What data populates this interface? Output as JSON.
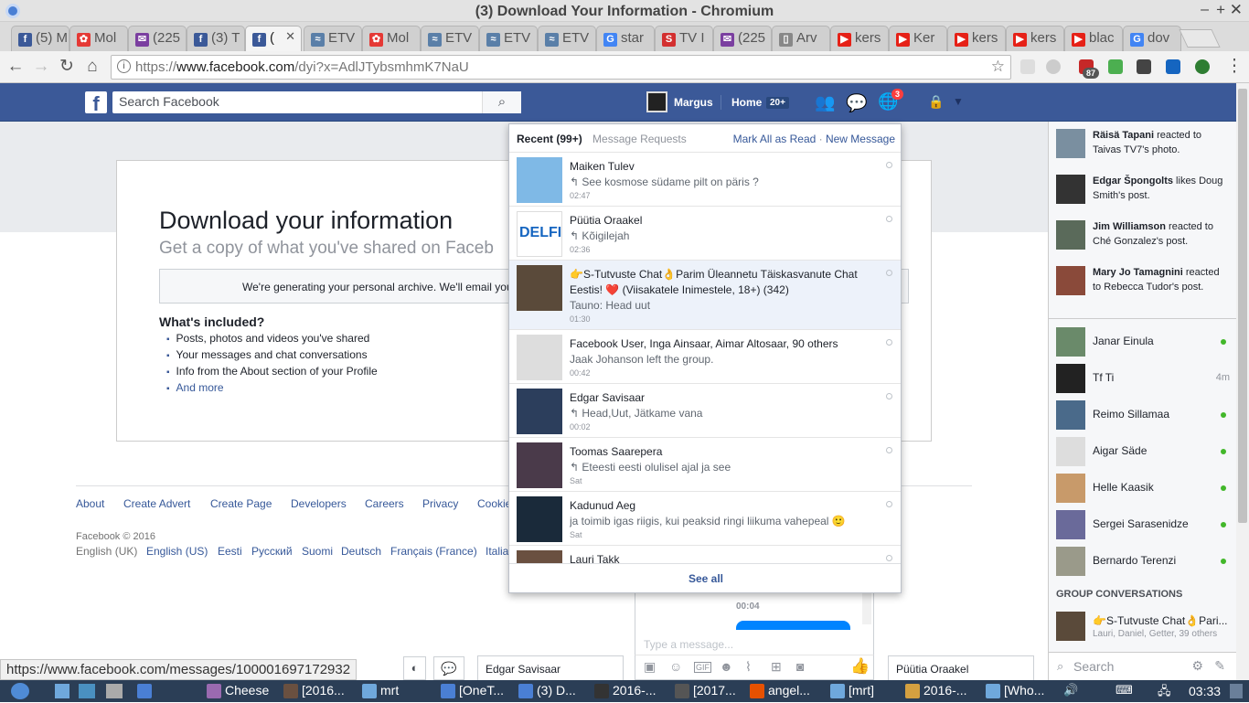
{
  "window": {
    "title": "(3) Download Your Information - Chromium"
  },
  "tabs": [
    {
      "label": "(5) M",
      "color": "#3b5998",
      "glyph": "f"
    },
    {
      "label": "Mol",
      "color": "#e53935",
      "glyph": "✿"
    },
    {
      "label": "(225",
      "color": "#7b3fa0",
      "glyph": "✉"
    },
    {
      "label": "(3) T",
      "color": "#3b5998",
      "glyph": "f"
    },
    {
      "label": "(",
      "color": "#3b5998",
      "glyph": "f",
      "active": true
    },
    {
      "label": "ETV",
      "color": "#5a7fa8",
      "glyph": "≈"
    },
    {
      "label": "Mol",
      "color": "#e53935",
      "glyph": "✿"
    },
    {
      "label": "ETV",
      "color": "#5a7fa8",
      "glyph": "≈"
    },
    {
      "label": "ETV",
      "color": "#5a7fa8",
      "glyph": "≈"
    },
    {
      "label": "ETV",
      "color": "#5a7fa8",
      "glyph": "≈"
    },
    {
      "label": "star",
      "color": "#4285f4",
      "glyph": "G"
    },
    {
      "label": "TV I",
      "color": "#d32f2f",
      "glyph": "S"
    },
    {
      "label": "(225",
      "color": "#7b3fa0",
      "glyph": "✉"
    },
    {
      "label": "Arv",
      "color": "#888888",
      "glyph": "▯"
    },
    {
      "label": "kers",
      "color": "#e62117",
      "glyph": "▶"
    },
    {
      "label": "Ker",
      "color": "#e62117",
      "glyph": "▶"
    },
    {
      "label": "kers",
      "color": "#e62117",
      "glyph": "▶"
    },
    {
      "label": "kers",
      "color": "#e62117",
      "glyph": "▶"
    },
    {
      "label": "blac",
      "color": "#e62117",
      "glyph": "▶"
    },
    {
      "label": "dov",
      "color": "#4285f4",
      "glyph": "G"
    }
  ],
  "omnibox": {
    "scheme": "https://",
    "host": "www.facebook.com",
    "path": "/dyi?x=AdlJTybsmhmK7NaU"
  },
  "extensions": {
    "badge": "87"
  },
  "fb": {
    "search_placeholder": "Search Facebook",
    "user": "Margus",
    "home": "Home",
    "home_count": "20+",
    "notif_count": "3"
  },
  "main": {
    "title": "Download your information",
    "subtitle": "Get a copy of what you've shared on Faceb",
    "generating": "We're generating your personal archive. We'll email you",
    "included_title": "What's included?",
    "included": [
      "Posts, photos and videos you've shared",
      "Your messages and chat conversations",
      "Info from the About section of your Profile",
      "And more"
    ]
  },
  "footer": {
    "links": [
      "About",
      "Create Advert",
      "Create Page",
      "Developers",
      "Careers",
      "Privacy",
      "Cookie"
    ],
    "copyright": "Facebook © 2016",
    "current_lang": "English (UK)",
    "langs": [
      "English (US)",
      "Eesti",
      "Русский",
      "Suomi",
      "Deutsch",
      "Français (France)",
      "Italia"
    ]
  },
  "messages": {
    "recent": "Recent (99+)",
    "requests": "Message Requests",
    "mark_all": "Mark All as Read",
    "sep": " · ",
    "new_message": "New Message",
    "see_all": "See all",
    "items": [
      {
        "name": "Maiken Tulev",
        "preview": "↰ See kosmose südame pilt on päris ?",
        "time": "02:47",
        "color": "#7fb9e6"
      },
      {
        "name": "Püütia Oraakel",
        "preview": "↰ Kõigilejah",
        "time": "02:36",
        "color": "#ffffff"
      },
      {
        "name": "👉S-Tutvuste Chat👌Parim Üleannetu Täiskasvanute Chat",
        "name2": "Eestis! ❤️ (Viisakatele Inimestele, 18+) (342)",
        "preview": "Tauno: Head uut",
        "time": "01:30",
        "color": "#5a4a3a",
        "unread": true
      },
      {
        "name": "Facebook User, Inga Ainsaar, Aimar Altosaar, 90 others",
        "preview": "Jaak Johanson left the group.",
        "time": "00:42",
        "color": "#dddddd"
      },
      {
        "name": "Edgar Savisaar",
        "preview": "↰ Head,Uut, Jätkame vana",
        "time": "00:02",
        "color": "#2c3e5c"
      },
      {
        "name": "Toomas Saarepera",
        "preview": "↰ Eteesti eesti olulisel ajal ja see",
        "time": "Sat",
        "color": "#4a3a4a"
      },
      {
        "name": "Kadunud Aeg",
        "preview": "ja toimib igas riigis, kui peaksid ringi liikuma vahepeal 🙂",
        "time": "Sat",
        "color": "#1a2a3a"
      },
      {
        "name": "Lauri Takk",
        "preview": "",
        "time": "",
        "color": "#6a5040"
      }
    ]
  },
  "ticker": [
    {
      "actor": "Räisä Tapani",
      "text": " reacted to Taivas TV7's photo.",
      "color": "#7a8fa0"
    },
    {
      "actor": "Edgar Špongolts",
      "text": " likes Doug Smith's post.",
      "color": "#333333"
    },
    {
      "actor": "Jim Williamson",
      "text": " reacted to Ché Gonzalez's post.",
      "color": "#5a6a5a"
    },
    {
      "actor": "Mary Jo Tamagnini",
      "text": " reacted to Rebecca Tudor's post.",
      "color": "#8a4a3a"
    }
  ],
  "contacts": [
    {
      "name": "Janar Einula",
      "status": "online",
      "color": "#6a8a6a"
    },
    {
      "name": "Tf Ti",
      "status": "4m",
      "color": "#222222"
    },
    {
      "name": "Reimo Sillamaa",
      "status": "online",
      "color": "#4a6a8a"
    },
    {
      "name": "Aigar Säde",
      "status": "online",
      "color": "#dddddd"
    },
    {
      "name": "Helle Kaasik",
      "status": "online",
      "color": "#c89a6a"
    },
    {
      "name": "Sergei Sarasenidze",
      "status": "online",
      "color": "#6a6a9a"
    },
    {
      "name": "Bernardo Terenzi",
      "status": "online",
      "color": "#9a9a8a"
    }
  ],
  "group_title": "GROUP CONVERSATIONS",
  "group": {
    "name": "👉S-Tutvuste Chat👌Pari...",
    "members": "Lauri, Daniel, Getter, 39 others"
  },
  "sidebar_search": "Search",
  "chat": {
    "time": "00:04",
    "placeholder": "Type a message...",
    "tab1": "Edgar Savisaar",
    "tab2": "Püütia Oraakel"
  },
  "statusbar": "https://www.facebook.com/messages/100001697172932",
  "taskbar": {
    "items": [
      "",
      "Cheese",
      "[2016...",
      "mrt",
      "[OneT...",
      "(3) D...",
      "2016-...",
      "[2017...",
      "angel...",
      "[mrt]",
      "2016-...",
      "[Who..."
    ],
    "clock": "03:33"
  }
}
